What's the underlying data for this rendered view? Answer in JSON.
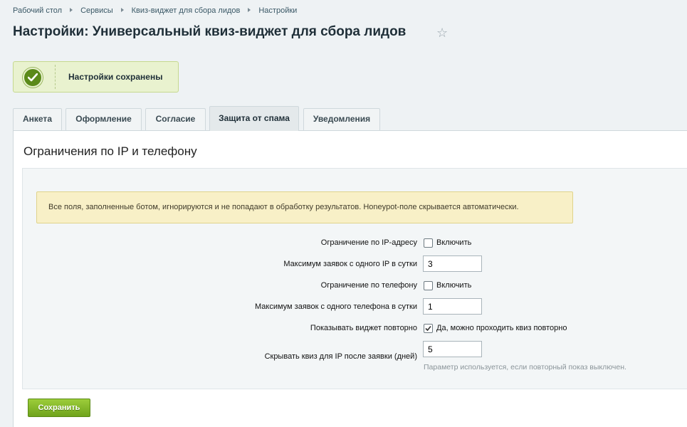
{
  "breadcrumbs": [
    "Рабочий стол",
    "Сервисы",
    "Квиз-виджет для сбора лидов",
    "Настройки"
  ],
  "page_title": "Настройки: Универсальный квиз-виджет для сбора лидов",
  "favorite_icon": "star-icon",
  "notice": {
    "text": "Настройки сохранены",
    "icon": "check-icon",
    "color": "#5b8a1a"
  },
  "tabs": [
    {
      "label": "Анкета"
    },
    {
      "label": "Оформление"
    },
    {
      "label": "Согласие"
    },
    {
      "label": "Защита от спама",
      "active": true
    },
    {
      "label": "Уведомления"
    }
  ],
  "section": {
    "title": "Ограничения по IP и телефону",
    "warning": "Все поля, заполненные ботом, игнорируются и не попадают в обработку результатов. Honeypot-поле скрывается автоматически.",
    "fields": {
      "ip_limit": {
        "label": "Ограничение по IP-адресу",
        "checkbox_label": "Включить",
        "checked": false
      },
      "max_per_ip": {
        "label": "Максимум заявок с одного IP в сутки",
        "value": "3"
      },
      "phone_limit": {
        "label": "Ограничение по телефону",
        "checkbox_label": "Включить",
        "checked": false
      },
      "max_per_phone": {
        "label": "Максимум заявок с одного телефона в сутки",
        "value": "1"
      },
      "show_again": {
        "label": "Показывать виджет повторно",
        "checkbox_label": "Да, можно проходить квиз повторно",
        "checked": true
      },
      "hide_days": {
        "label": "Скрывать квиз для IP после заявки (дней)",
        "value": "5",
        "hint": "Параметр используется, если повторный показ выключен."
      }
    }
  },
  "save_button": "Сохранить",
  "colors": {
    "accent_green": "#7ab32a",
    "warning_bg": "#f8f0c7",
    "notice_bg": "#e9f2cf"
  }
}
